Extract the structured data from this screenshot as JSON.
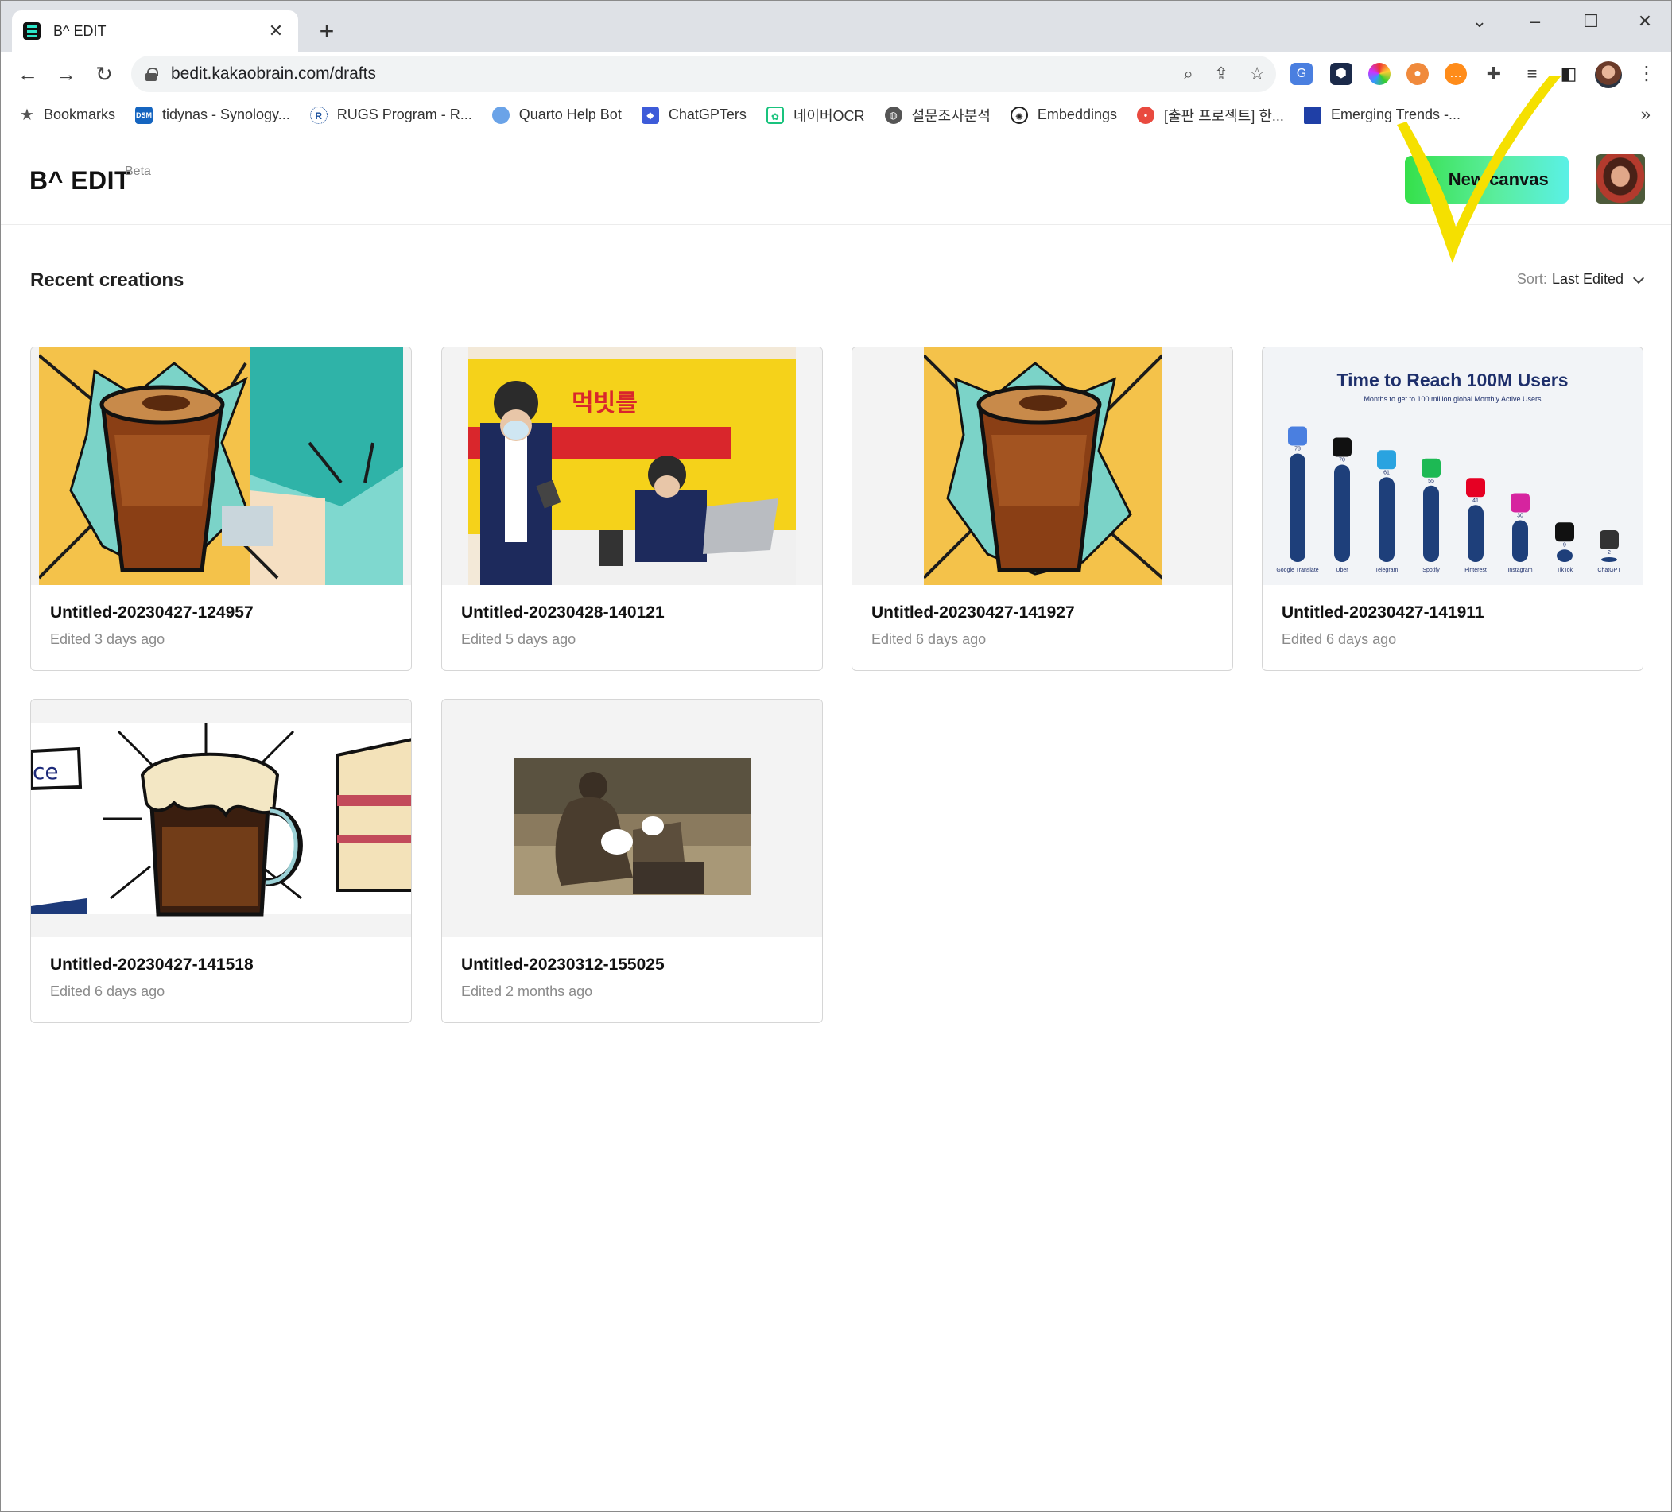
{
  "browser": {
    "tab_title": "B^ EDIT",
    "url": "bedit.kakaobrain.com/drafts",
    "bookmarks": [
      {
        "label": "Bookmarks",
        "icon": "star-icon"
      },
      {
        "label": "tidynas - Synology...",
        "icon": "dsm-icon"
      },
      {
        "label": "RUGS Program - R...",
        "icon": "r-icon"
      },
      {
        "label": "Quarto Help Bot",
        "icon": "quarto-icon"
      },
      {
        "label": "ChatGPTers",
        "icon": "chatgpters-icon"
      },
      {
        "label": "네이버OCR",
        "icon": "clova-icon"
      },
      {
        "label": "설문조사분석",
        "icon": "globe-icon"
      },
      {
        "label": "Embeddings",
        "icon": "openai-icon"
      },
      {
        "label": "[출판 프로젝트] 한...",
        "icon": "project-icon"
      },
      {
        "label": "Emerging Trends -...",
        "icon": "trends-icon"
      }
    ]
  },
  "app": {
    "logo": "B^ EDIT",
    "beta": "Beta",
    "new_canvas_label": "New canvas"
  },
  "main": {
    "section_title": "Recent creations",
    "sort_label": "Sort:",
    "sort_value": "Last Edited",
    "cards": [
      {
        "title": "Untitled-20230427-124957",
        "meta": "Edited 3 days ago",
        "thumbnail": "pop-art coffee glass"
      },
      {
        "title": "Untitled-20230428-140121",
        "meta": "Edited 5 days ago",
        "thumbnail": "men at yellow desk with laptop"
      },
      {
        "title": "Untitled-20230427-141927",
        "meta": "Edited 6 days ago",
        "thumbnail": "pop-art coffee glass"
      },
      {
        "title": "Untitled-20230427-141911",
        "meta": "Edited 6 days ago",
        "thumbnail": "time to reach 100M users chart"
      },
      {
        "title": "Untitled-20230427-141518",
        "meta": "Edited 6 days ago",
        "thumbnail": "beer mug and cake cartoon"
      },
      {
        "title": "Untitled-20230312-155025",
        "meta": "Edited 2 months ago",
        "thumbnail": "bronze statue with laptop"
      }
    ],
    "thumb_chart": {
      "title": "Time to Reach 100M Users",
      "subtitle": "Months to get to 100 million global Monthly Active Users",
      "apps": [
        {
          "name": "Google Translate",
          "months": 78
        },
        {
          "name": "Uber",
          "months": 70
        },
        {
          "name": "Telegram",
          "months": 61
        },
        {
          "name": "Spotify",
          "months": 55
        },
        {
          "name": "Pinterest",
          "months": 41
        },
        {
          "name": "Instagram",
          "months": 30
        },
        {
          "name": "TikTok",
          "months": 9
        },
        {
          "name": "ChatGPT",
          "months": 2
        }
      ]
    }
  }
}
